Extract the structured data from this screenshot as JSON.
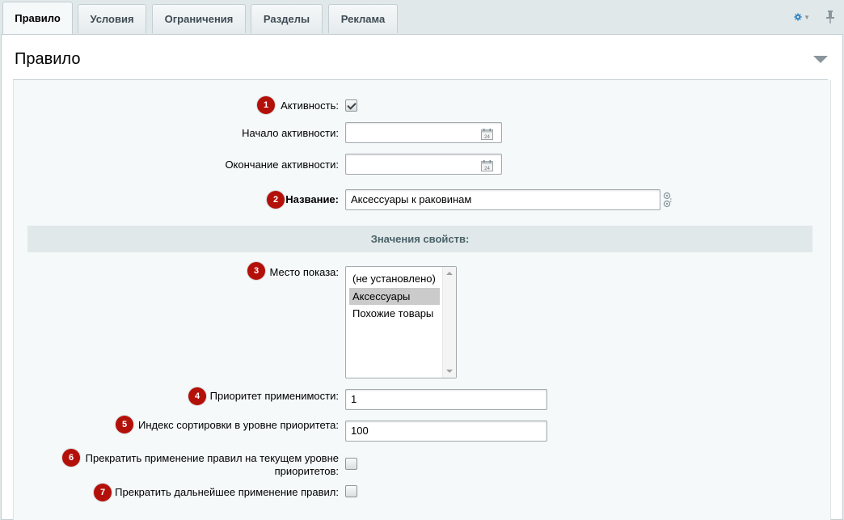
{
  "tabs": [
    {
      "label": "Правило",
      "active": true
    },
    {
      "label": "Условия",
      "active": false
    },
    {
      "label": "Ограничения",
      "active": false
    },
    {
      "label": "Разделы",
      "active": false
    },
    {
      "label": "Реклама",
      "active": false
    }
  ],
  "toolbar": {
    "settings_icon": "gear-icon",
    "pin_icon": "pin-icon"
  },
  "panel": {
    "title": "Правило"
  },
  "fields": {
    "active": {
      "badge": "1",
      "label": "Активность:",
      "checked": true
    },
    "start": {
      "label": "Начало активности:",
      "value": ""
    },
    "end": {
      "label": "Окончание активности:",
      "value": ""
    },
    "name": {
      "badge": "2",
      "label": "Название:",
      "value": "Аксессуары к раковинам"
    }
  },
  "section": {
    "title": "Значения свойств:"
  },
  "place": {
    "badge": "3",
    "label": "Место показа:",
    "options": [
      "(не установлено)",
      "Аксессуары",
      "Похожие товары"
    ],
    "selected": "Аксессуары"
  },
  "priority": {
    "badge": "4",
    "label": "Приоритет применимости:",
    "value": "1"
  },
  "sort_index": {
    "badge": "5",
    "label": "Индекс сортировки в уровне приоритета:",
    "value": "100"
  },
  "stop_level": {
    "badge": "6",
    "label_line1": "Прекратить применение правил на текущем уровне",
    "label_line2": "приоритетов:",
    "checked": false
  },
  "stop_further": {
    "badge": "7",
    "label": "Прекратить дальнейшее применение правил:",
    "checked": false
  },
  "colors": {
    "badge": "#b4100a",
    "accent": "#2a7fc1",
    "background": "#e0e8ea"
  }
}
